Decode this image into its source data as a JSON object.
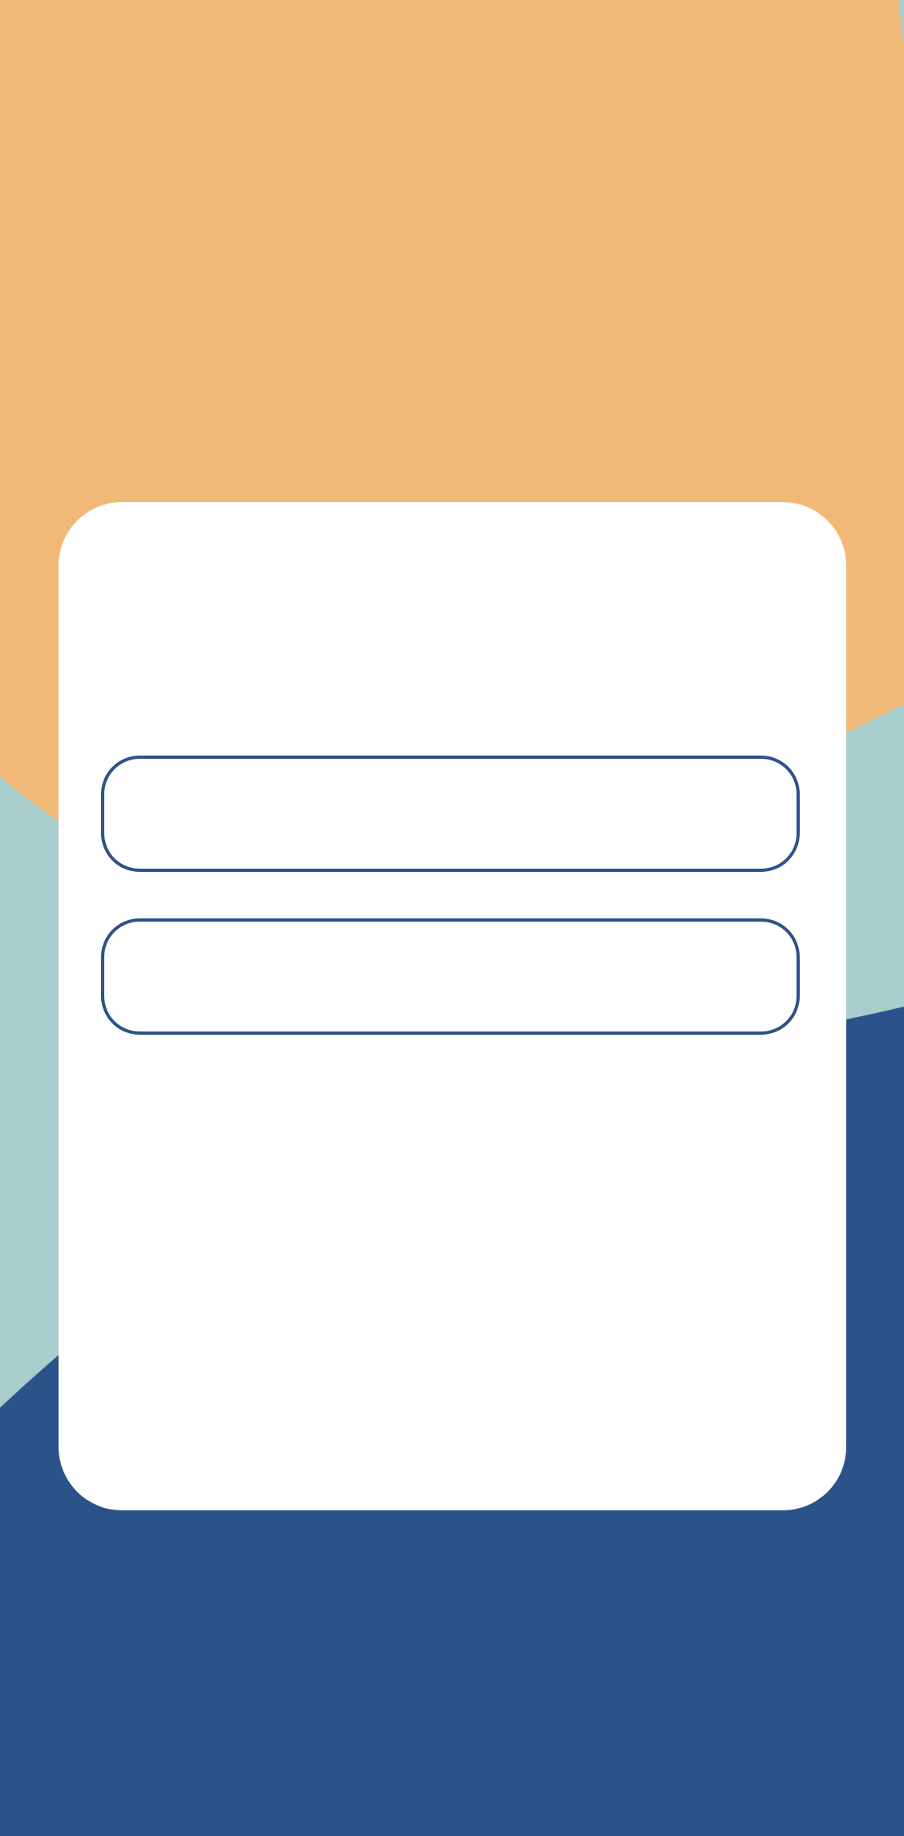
{
  "colors": {
    "background_top": "#f0b978",
    "background_middle": "#a7cdcc",
    "background_bottom": "#2b5389",
    "card": "#ffffff",
    "field_border": "#2b5389"
  },
  "form": {
    "username": {
      "value": "",
      "placeholder": ""
    },
    "password": {
      "value": "",
      "placeholder": ""
    }
  }
}
